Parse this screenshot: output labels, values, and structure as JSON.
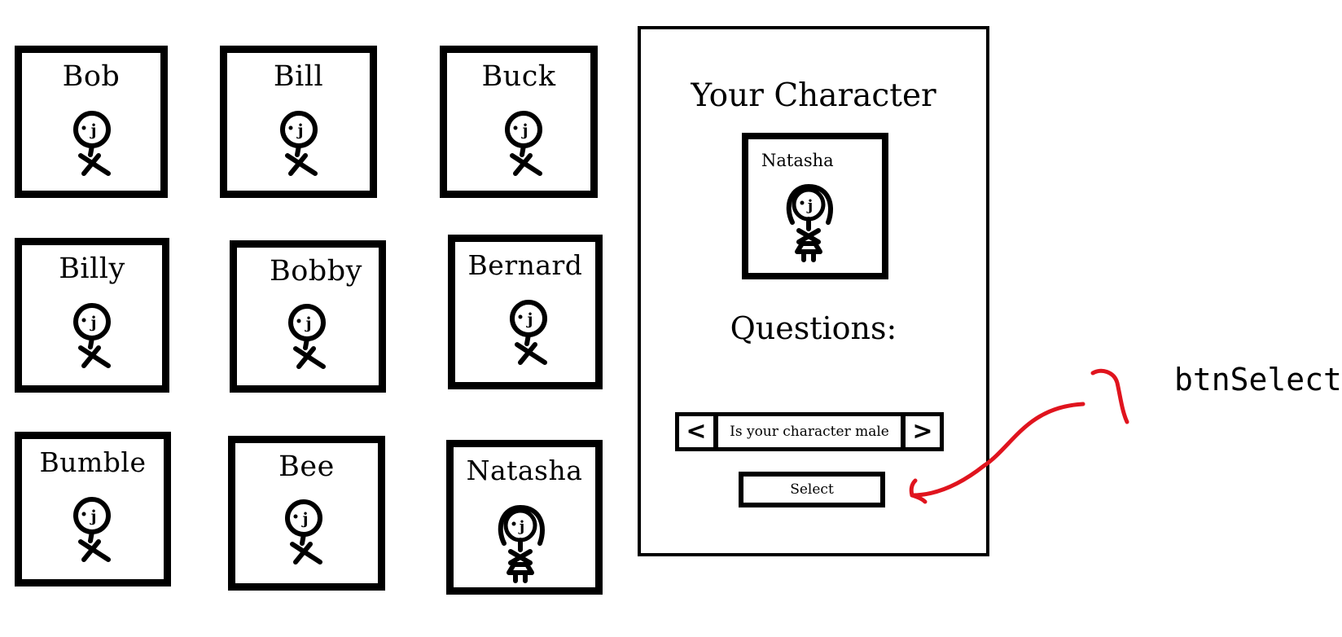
{
  "characters": [
    {
      "name": "Bob"
    },
    {
      "name": "Bill"
    },
    {
      "name": "Buck"
    },
    {
      "name": "Billy"
    },
    {
      "name": "Bobby"
    },
    {
      "name": "Bernard"
    },
    {
      "name": "Bumble"
    },
    {
      "name": "Bee"
    },
    {
      "name": "Natasha"
    }
  ],
  "panel": {
    "title": "Your Character",
    "selected_name": "Natasha",
    "questions_label": "Questions:",
    "question_text": "Is your character male",
    "prev_label": "<",
    "next_label": ">",
    "select_label": "Select"
  },
  "annotation": {
    "label": "btnSelect",
    "color": "#e0141e"
  },
  "icons": {
    "male_figure": "stick-figure-male-icon",
    "female_figure": "stick-figure-female-icon"
  }
}
